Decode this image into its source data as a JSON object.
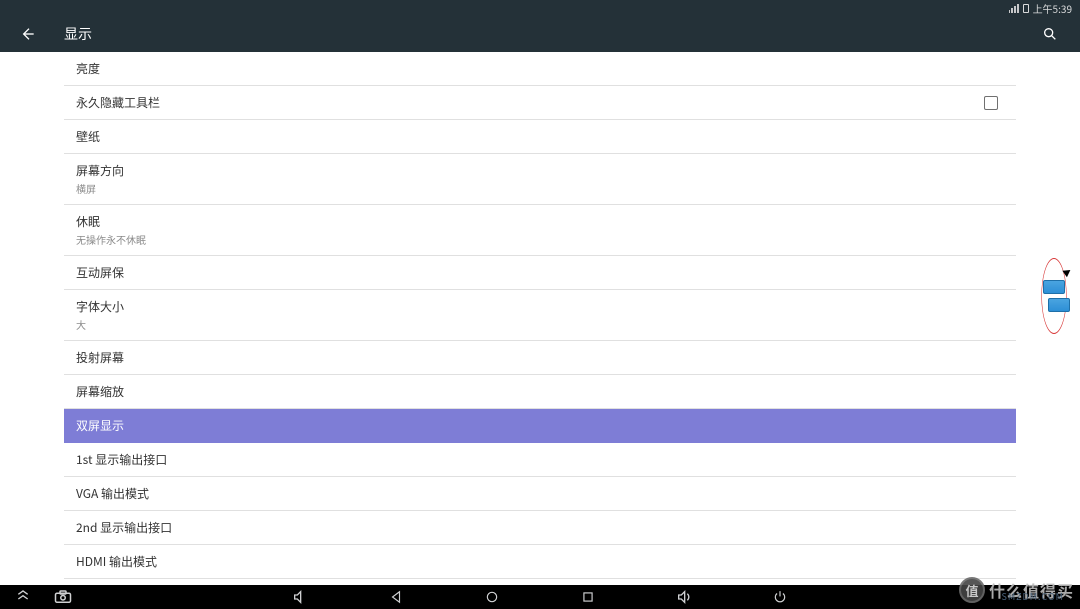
{
  "statusbar": {
    "time": "上午5:39"
  },
  "appbar": {
    "title": "显示"
  },
  "items": [
    {
      "title": "亮度",
      "sub": "",
      "checkbox": false,
      "selected": false
    },
    {
      "title": "永久隐藏工具栏",
      "sub": "",
      "checkbox": true,
      "selected": false
    },
    {
      "title": "壁纸",
      "sub": "",
      "checkbox": false,
      "selected": false
    },
    {
      "title": "屏幕方向",
      "sub": "横屏",
      "checkbox": false,
      "selected": false
    },
    {
      "title": "休眠",
      "sub": "无操作永不休眠",
      "checkbox": false,
      "selected": false
    },
    {
      "title": "互动屏保",
      "sub": "",
      "checkbox": false,
      "selected": false
    },
    {
      "title": "字体大小",
      "sub": "大",
      "checkbox": false,
      "selected": false
    },
    {
      "title": "投射屏幕",
      "sub": "",
      "checkbox": false,
      "selected": false
    },
    {
      "title": "屏幕缩放",
      "sub": "",
      "checkbox": false,
      "selected": false
    },
    {
      "title": "双屏显示",
      "sub": "",
      "checkbox": false,
      "selected": true
    },
    {
      "title": "1st 显示输出接口",
      "sub": "",
      "checkbox": false,
      "selected": false
    },
    {
      "title": "VGA 输出模式",
      "sub": "",
      "checkbox": false,
      "selected": false
    },
    {
      "title": "2nd 显示输出接口",
      "sub": "",
      "checkbox": false,
      "selected": false
    },
    {
      "title": "HDMI 输出模式",
      "sub": "",
      "checkbox": false,
      "selected": false
    }
  ],
  "watermark": {
    "logo": "值",
    "text": "什么值得买",
    "sub": "SMZDM.COM"
  }
}
